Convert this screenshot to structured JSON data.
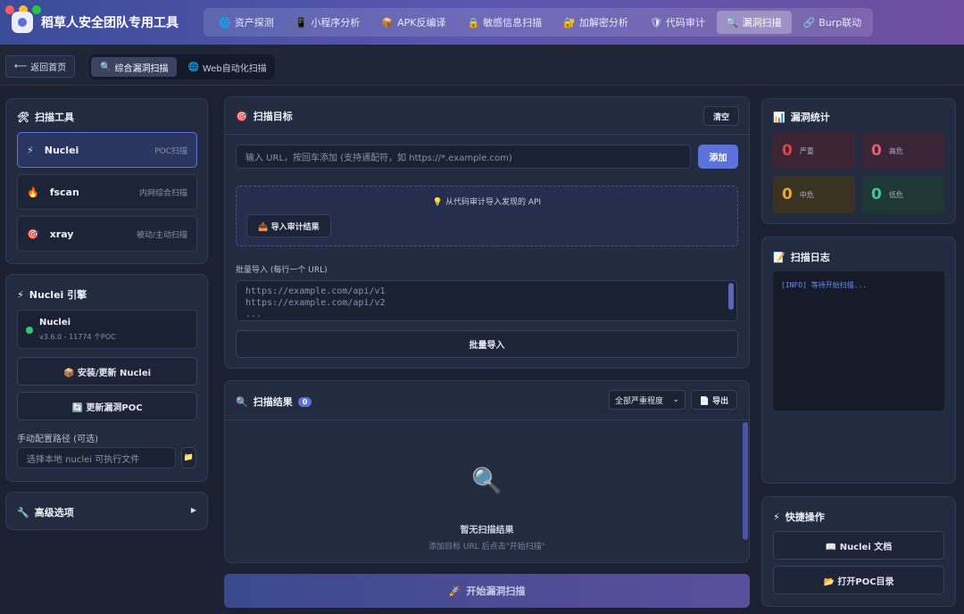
{
  "app": {
    "title": "稻草人安全团队专用工具"
  },
  "window_controls": {
    "close": "#ff5f57",
    "minimize": "#febc2e",
    "maximize": "#28c840"
  },
  "nav": {
    "tabs": [
      {
        "icon": "🌐",
        "label": "资产探测"
      },
      {
        "icon": "📱",
        "label": "小程序分析"
      },
      {
        "icon": "📦",
        "label": "APK反编译"
      },
      {
        "icon": "🔒",
        "label": "敏感信息扫描"
      },
      {
        "icon": "🔐",
        "label": "加解密分析"
      },
      {
        "icon": "🛡",
        "label": "代码审计"
      },
      {
        "icon": "🔍",
        "label": "漏洞扫描"
      },
      {
        "icon": "🔗",
        "label": "Burp联动"
      }
    ]
  },
  "subnav": {
    "back": "返回首页",
    "tabs": [
      {
        "icon": "🔍",
        "label": "综合漏洞扫描"
      },
      {
        "icon": "🌐",
        "label": "Web自动化扫描"
      }
    ]
  },
  "tools": {
    "title": "扫描工具",
    "items": [
      {
        "icon": "⚡",
        "name": "Nuclei",
        "desc": "POC扫描"
      },
      {
        "icon": "🔥",
        "name": "fscan",
        "desc": "内网综合扫描"
      },
      {
        "icon": "🎯",
        "name": "xray",
        "desc": "被动/主动扫描"
      }
    ]
  },
  "engine": {
    "title": "Nuclei 引擎",
    "name": "Nuclei",
    "version": "v3.6.0 - 11774 个POC",
    "status_color": "#2ecc71",
    "install_btn": "📦 安装/更新 Nuclei",
    "update_btn": "🔄 更新漏洞POC",
    "path_label": "手动配置路径 (可选)",
    "path_placeholder": "选择本地 nuclei 可执行文件"
  },
  "advanced": {
    "title": "高级选项",
    "arrow": "▶"
  },
  "target": {
    "title": "扫描目标",
    "clear": "清空",
    "url_placeholder": "输入 URL，按回车添加 (支持通配符，如 https://*.example.com)",
    "add": "添加",
    "import_hint": "💡 从代码审计导入发现的 API",
    "import_btn": "📥 导入审计结果",
    "batch_label": "批量导入 (每行一个 URL)",
    "batch_text": "https://example.com/api/v1\nhttps://example.com/api/v2\n...",
    "batch_btn": "批量导入"
  },
  "results": {
    "title": "扫描结果",
    "count": "0",
    "filter": "全部严重程度",
    "export": "📄 导出",
    "empty_title": "暂无扫描结果",
    "empty_desc": "添加目标 URL 后点击\"开始扫描\""
  },
  "start": {
    "label": "开始漏洞扫描"
  },
  "stats": {
    "title": "漏洞统计",
    "items": [
      {
        "value": "0",
        "label": "严重",
        "color": "#e0454f",
        "bg": "#3d2432"
      },
      {
        "value": "0",
        "label": "高危",
        "color": "#e85d70",
        "bg": "#3a2536"
      },
      {
        "value": "0",
        "label": "中危",
        "color": "#e7a73a",
        "bg": "#3a3324"
      },
      {
        "value": "0",
        "label": "低危",
        "color": "#3fc59a",
        "bg": "#1f3836"
      }
    ]
  },
  "log": {
    "title": "扫描日志",
    "line": "[INFO] 等待开始扫描..."
  },
  "quick": {
    "title": "快捷操作",
    "docs": "📖 Nuclei 文档",
    "poc_dir": "📂 打开POC目录"
  }
}
